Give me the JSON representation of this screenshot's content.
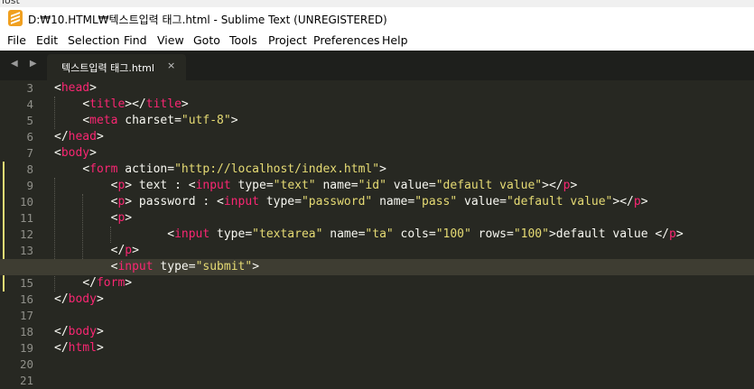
{
  "background_window_text": "lost",
  "window": {
    "title": "D:₩10.HTML₩텍스트입력 태그.html - Sublime Text (UNREGISTERED)",
    "app_icon": "sublime-text-icon"
  },
  "menu": [
    "File",
    "Edit",
    "Selection",
    "Find",
    "View",
    "Goto",
    "Tools",
    "Project",
    "Preferences",
    "Help"
  ],
  "tabs": [
    {
      "label": "텍스트입력 태그.html",
      "close_icon": "×"
    }
  ],
  "navigation": {
    "arrows": "◀ ▶"
  },
  "editor": {
    "current_line": 14,
    "modified_lines": [
      8,
      9,
      10,
      11,
      12,
      13,
      14,
      15
    ],
    "colors": {
      "background": "#272822",
      "tag": "#f92672",
      "attribute": "#a6e22e",
      "string": "#e6db74",
      "punctuation": "#f8f8f2",
      "line_number": "#90908a"
    },
    "lines": [
      {
        "number": "3",
        "text": "<head>"
      },
      {
        "number": "4",
        "text": "    <title></title>"
      },
      {
        "number": "5",
        "text": "    <meta charset=\"utf-8\">"
      },
      {
        "number": "6",
        "text": "</head>"
      },
      {
        "number": "7",
        "text": "<body>"
      },
      {
        "number": "8",
        "text": "    <form action=\"http://localhost/index.html\">"
      },
      {
        "number": "9",
        "text": "        <p> text : <input type=\"text\" name=\"id\" value=\"default value\"></p>"
      },
      {
        "number": "10",
        "text": "        <p> password : <input type=\"password\" name=\"pass\" value=\"default value\"></p>"
      },
      {
        "number": "11",
        "text": "        <p>"
      },
      {
        "number": "12",
        "text": "                <input type=\"textarea\" name=\"ta\" cols=\"100\" rows=\"100\">default value </p>"
      },
      {
        "number": "13",
        "text": "        </p>"
      },
      {
        "number": "14",
        "text": "        <input type=\"submit\">"
      },
      {
        "number": "15",
        "text": "    </form>"
      },
      {
        "number": "16",
        "text": "</body>"
      },
      {
        "number": "17",
        "text": ""
      },
      {
        "number": "18",
        "text": "</body>"
      },
      {
        "number": "19",
        "text": "</html>"
      },
      {
        "number": "20",
        "text": ""
      },
      {
        "number": "21",
        "text": ""
      }
    ]
  }
}
